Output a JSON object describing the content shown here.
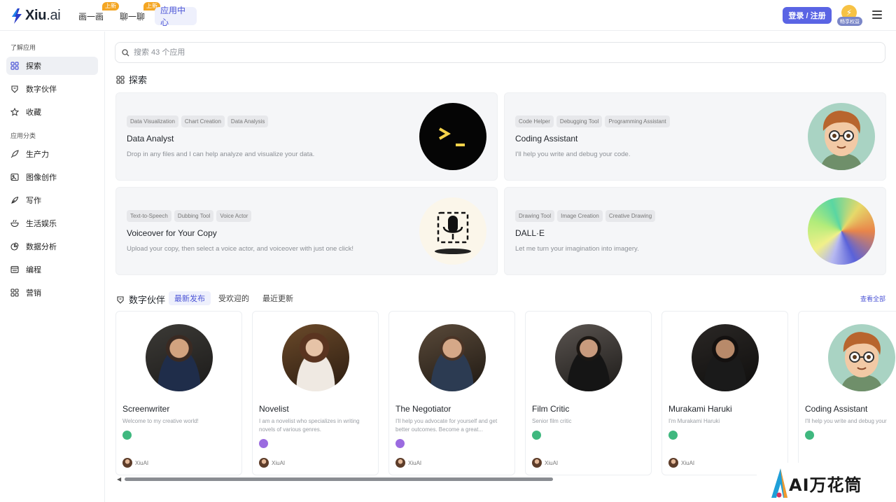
{
  "header": {
    "logo": {
      "brand": "Xiu",
      "suffix": ".ai"
    },
    "nav": [
      {
        "label": "画一画",
        "badge": "上新"
      },
      {
        "label": "聊一聊",
        "badge": "上新"
      },
      {
        "label": "应用中心"
      }
    ],
    "login_label": "登录 / 注册",
    "perk_label": "畅享权益"
  },
  "sidebar": {
    "section1": "了解应用",
    "items1": [
      {
        "label": "探索",
        "icon": "grid-icon",
        "active": true
      },
      {
        "label": "数字伙伴",
        "icon": "robot-icon"
      },
      {
        "label": "收藏",
        "icon": "star-icon"
      }
    ],
    "section2": "应用分类",
    "items2": [
      {
        "label": "生产力",
        "icon": "rocket-icon"
      },
      {
        "label": "图像创作",
        "icon": "image-icon"
      },
      {
        "label": "写作",
        "icon": "pen-icon"
      },
      {
        "label": "生活娱乐",
        "icon": "bowl-icon"
      },
      {
        "label": "数据分析",
        "icon": "pie-chart-icon"
      },
      {
        "label": "编程",
        "icon": "code-icon"
      },
      {
        "label": "营销",
        "icon": "grid-icon"
      }
    ]
  },
  "search": {
    "placeholder": "搜索 43 个应用"
  },
  "explore": {
    "title": "探索",
    "cards": [
      {
        "tags": [
          "Data Visualization",
          "Chart Creation",
          "Data Analysis"
        ],
        "title": "Data Analyst",
        "desc": "Drop in any files and I can help analyze and visualize your data."
      },
      {
        "tags": [
          "Code Helper",
          "Debugging Tool",
          "Programming Assistant"
        ],
        "title": "Coding Assistant",
        "desc": "I'll help you write and debug your code."
      },
      {
        "tags": [
          "Text-to-Speech",
          "Dubbing Tool",
          "Voice Actor"
        ],
        "title": "Voiceover for Your Copy",
        "desc": "Upload your copy, then select a voice actor, and voiceover with just one click!"
      },
      {
        "tags": [
          "Drawing Tool",
          "Image Creation",
          "Creative Drawing"
        ],
        "title": "DALL·E",
        "desc": "Let me turn your imagination into imagery."
      }
    ]
  },
  "partners": {
    "title": "数字伙伴",
    "tabs": [
      "最新发布",
      "受欢迎的",
      "最近更新"
    ],
    "view_all": "查看全部",
    "cards": [
      {
        "name": "Screenwriter",
        "desc": "Welcome to my creative world!",
        "model_color": "#3fb87f",
        "author": "XiuAI"
      },
      {
        "name": "Novelist",
        "desc": "I am a novelist who specializes in writing novels of various genres.",
        "model_color": "#9b6be0",
        "author": "XiuAI"
      },
      {
        "name": "The Negotiator",
        "desc": "I'll help you advocate for yourself and get better outcomes. Become a great...",
        "model_color": "#9b6be0",
        "author": "XiuAI"
      },
      {
        "name": "Film Critic",
        "desc": "Senior film critic",
        "model_color": "#3fb87f",
        "author": "XiuAI"
      },
      {
        "name": "Murakami Haruki",
        "desc": "I'm Murakami Haruki",
        "model_color": "#3fb87f",
        "author": "XiuAI"
      },
      {
        "name": "Coding Assistant",
        "desc": "I'll help you write and debug your",
        "model_color": "#3fb87f",
        "author": "XiuAI"
      }
    ]
  },
  "watermark": {
    "text": "AI万花筒"
  }
}
